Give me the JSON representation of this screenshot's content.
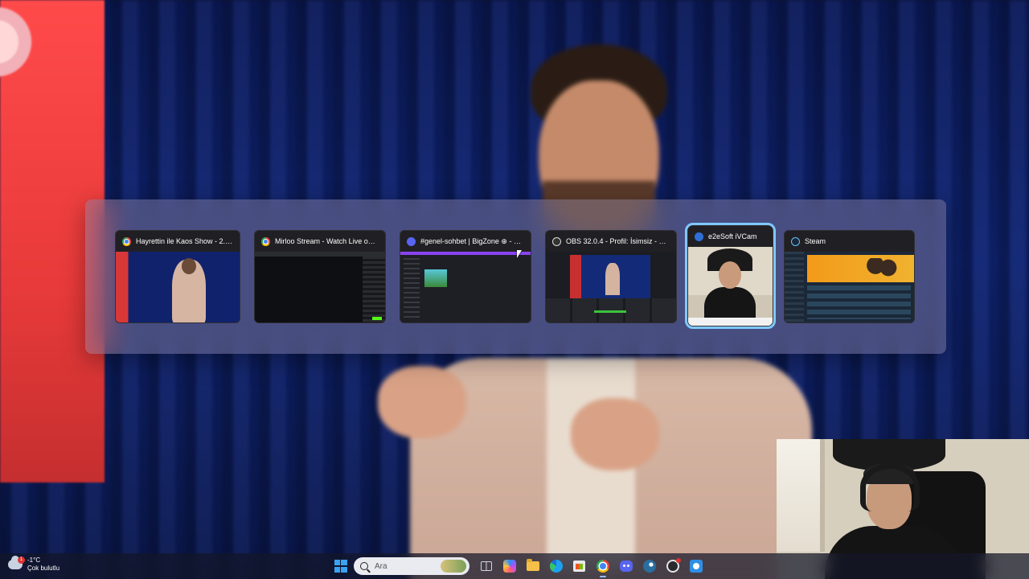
{
  "switcher": {
    "windows": [
      {
        "title": "Hayrettin ile Kaos Show - 2.Sezo...",
        "icon": "chrome-icon",
        "selected": false
      },
      {
        "title": "Mirloo Stream - Watch Live on Kick...",
        "icon": "chrome-icon",
        "selected": false
      },
      {
        "title": "#genel-sohbet | BigZone ⊕ - Disco...",
        "icon": "discord-icon",
        "selected": false
      },
      {
        "title": "OBS 32.0.4 - Profil: İsimsiz - Sahnel...",
        "icon": "obs-icon",
        "selected": false
      },
      {
        "title": "e2eSoft iVCam",
        "icon": "camera-icon",
        "selected": true
      },
      {
        "title": "Steam",
        "icon": "steam-icon",
        "selected": false
      }
    ]
  },
  "taskbar": {
    "weather": {
      "temperature": "-1°C",
      "condition": "Çok bulutlu",
      "badge": "1"
    },
    "search": {
      "placeholder": "Ara"
    },
    "apps": [
      {
        "name": "start",
        "icon": "windows-icon"
      },
      {
        "name": "task-view",
        "icon": "task-view-icon"
      },
      {
        "name": "copilot",
        "icon": "copilot-icon"
      },
      {
        "name": "file-explorer",
        "icon": "folder-icon"
      },
      {
        "name": "edge",
        "icon": "edge-icon"
      },
      {
        "name": "microsoft-store",
        "icon": "store-icon"
      },
      {
        "name": "chrome",
        "icon": "chrome-icon",
        "active": true
      },
      {
        "name": "discord",
        "icon": "discord-icon"
      },
      {
        "name": "steam",
        "icon": "steam-icon"
      },
      {
        "name": "obs",
        "icon": "obs-icon"
      },
      {
        "name": "ivcam",
        "icon": "camera-icon"
      }
    ]
  },
  "colors": {
    "selection_outline": "#7fc8ff",
    "switcher_bg": "#968caa"
  }
}
